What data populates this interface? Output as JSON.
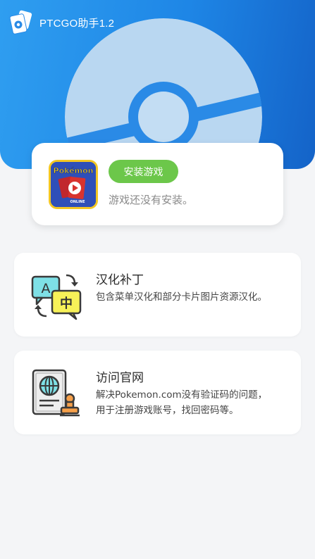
{
  "app_bar": {
    "title": "PTCGO助手1.2"
  },
  "install_card": {
    "button_label": "安装游戏",
    "status_text": "游戏还没有安装。",
    "game_icon_brand": "Pokémon",
    "game_icon_caption": "ONLINE"
  },
  "features": [
    {
      "title": "汉化补丁",
      "desc_lines": [
        "包含菜单汉化和部分卡片图片资源汉化。"
      ],
      "icon": "translate-icon"
    },
    {
      "title": "访问官网",
      "desc_lines": [
        "解决Pokemon.com没有验证码的问题，",
        "用于注册游戏账号，找回密码等。"
      ],
      "icon": "passport-icon"
    }
  ],
  "colors": {
    "header_start": "#2f9ef0",
    "header_end": "#1463c8",
    "install_button": "#6cc74a",
    "page_background": "#f4f5f7"
  }
}
